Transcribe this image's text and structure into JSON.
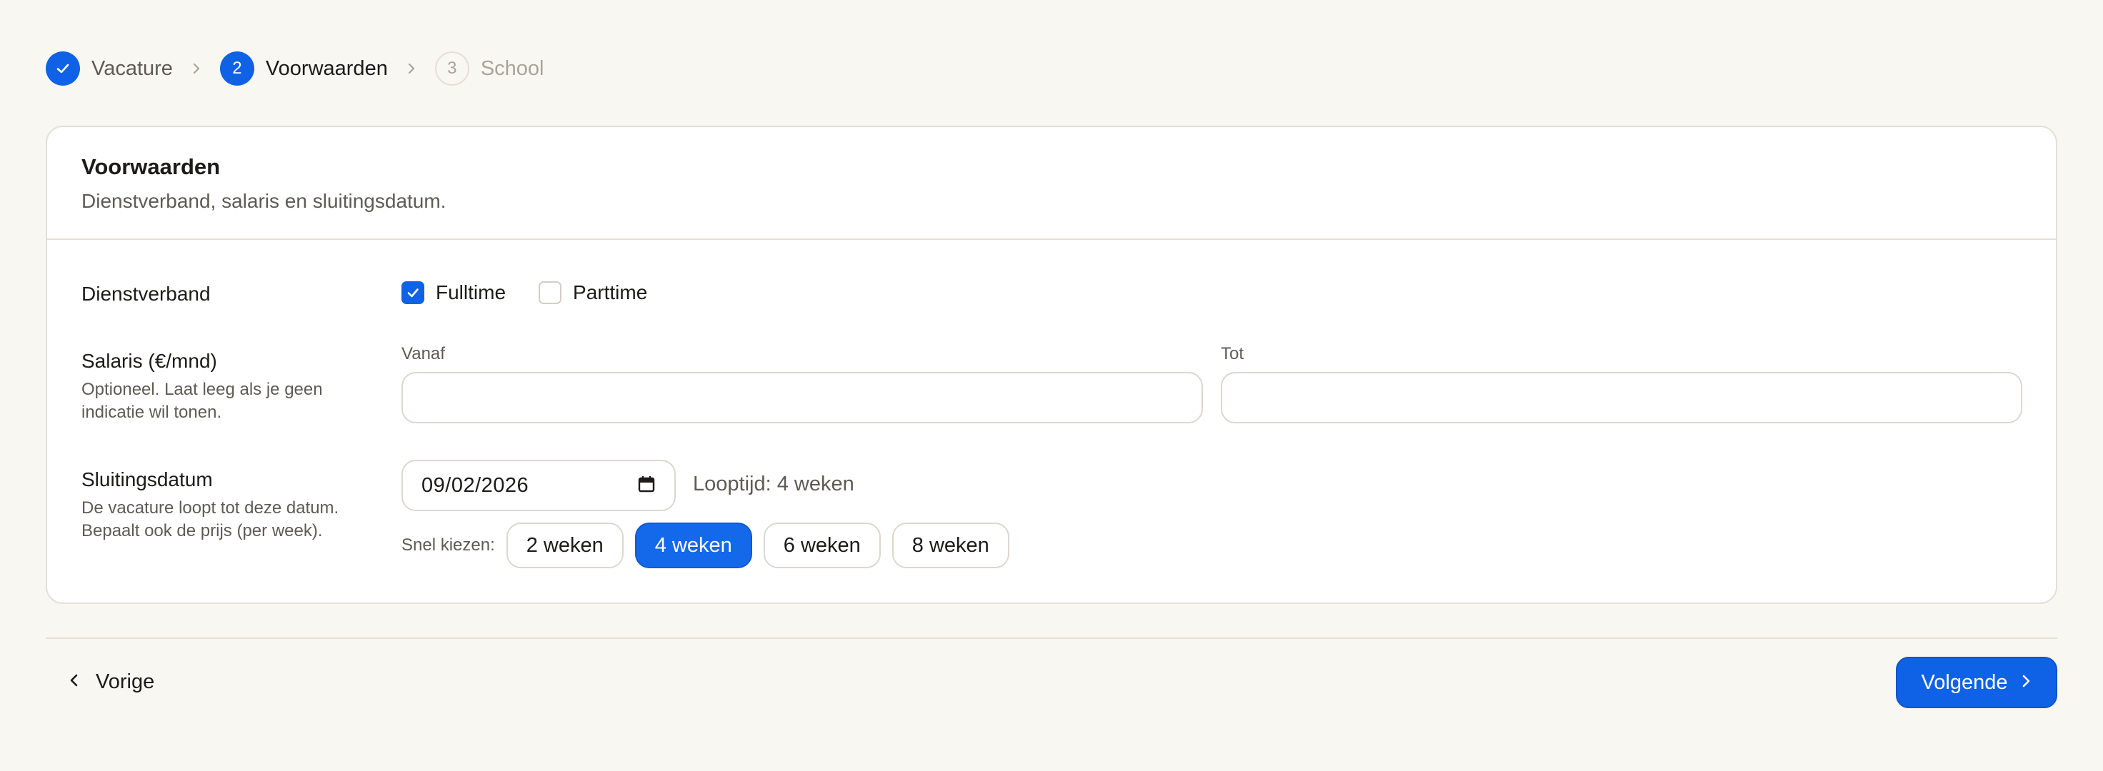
{
  "stepper": {
    "steps": [
      {
        "number": "1",
        "label": "Vacature",
        "state": "done"
      },
      {
        "number": "2",
        "label": "Voorwaarden",
        "state": "current"
      },
      {
        "number": "3",
        "label": "School",
        "state": "todo"
      }
    ]
  },
  "card": {
    "title": "Voorwaarden",
    "subtitle": "Dienstverband, salaris en sluitingsdatum."
  },
  "employment": {
    "label": "Dienstverband",
    "options": [
      {
        "label": "Fulltime",
        "checked": true
      },
      {
        "label": "Parttime",
        "checked": false
      }
    ]
  },
  "salary": {
    "label": "Salaris (€/mnd)",
    "help": "Optioneel. Laat leeg als je geen indicatie wil tonen.",
    "from_label": "Vanaf",
    "from_value": "",
    "to_label": "Tot",
    "to_value": ""
  },
  "closing": {
    "label": "Sluitingsdatum",
    "help": "De vacature loopt tot deze datum. Bepaalt ook de prijs (per week).",
    "date_value": "09/02/2026",
    "duration_text": "Looptijd: 4 weken",
    "quick_label": "Snel kiezen:",
    "quick_options": [
      {
        "label": "2 weken",
        "active": false
      },
      {
        "label": "4 weken",
        "active": true
      },
      {
        "label": "6 weken",
        "active": false
      },
      {
        "label": "8 weken",
        "active": false
      }
    ]
  },
  "nav": {
    "prev_label": "Vorige",
    "next_label": "Volgende"
  },
  "colors": {
    "accent": "#0f62e6",
    "background": "#f9f7f2",
    "card": "#ffffff",
    "border": "#e3e0d8"
  }
}
